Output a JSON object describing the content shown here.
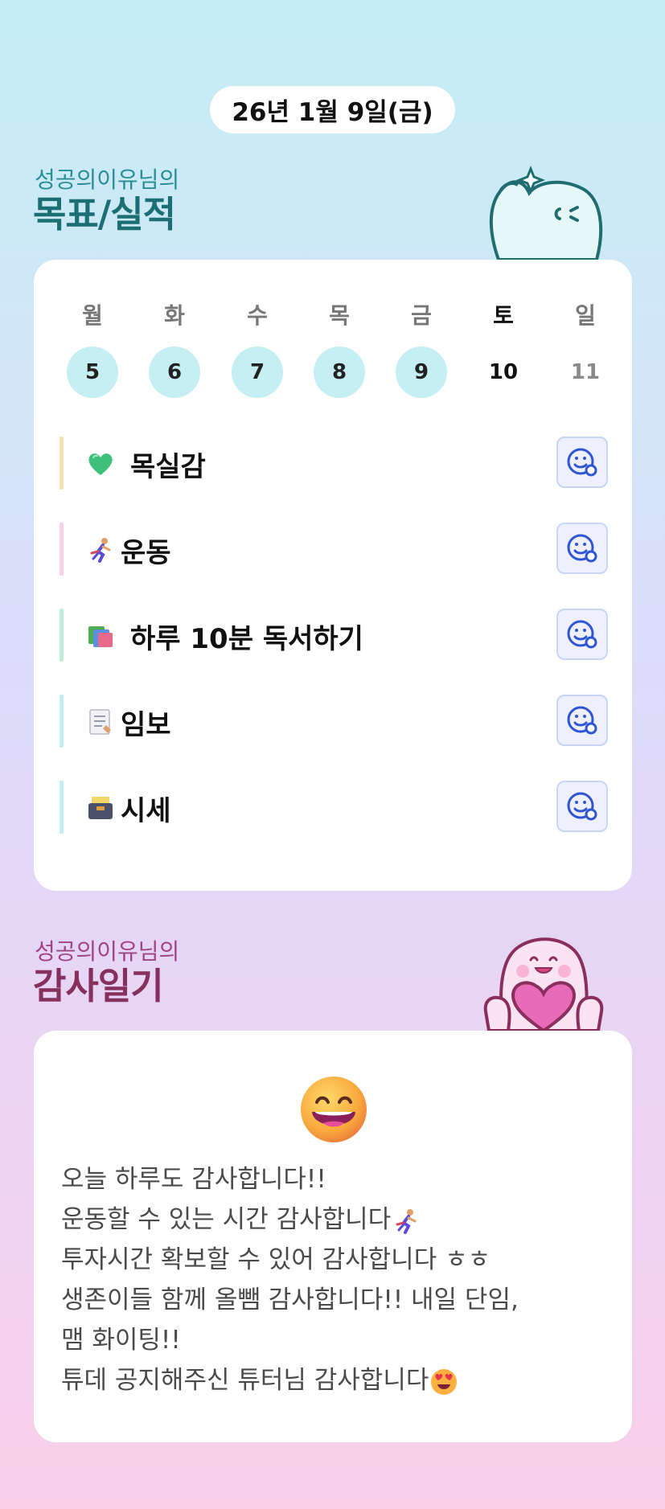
{
  "header": {
    "date": "26년 1월 9일(금)"
  },
  "goal_section": {
    "subtitle": "성공의이유님의",
    "title": "목표/실적",
    "week": [
      {
        "label": "월",
        "num": "5",
        "state": "done"
      },
      {
        "label": "화",
        "num": "6",
        "state": "done"
      },
      {
        "label": "수",
        "num": "7",
        "state": "done"
      },
      {
        "label": "목",
        "num": "8",
        "state": "done"
      },
      {
        "label": "금",
        "num": "9",
        "state": "done"
      },
      {
        "label": "토",
        "num": "10",
        "state": "today"
      },
      {
        "label": "일",
        "num": "11",
        "state": "future"
      }
    ],
    "goals": [
      {
        "emoji": "green-heart-icon",
        "label": "목실감",
        "bar_color": "#f8e2b0"
      },
      {
        "emoji": "runner-icon",
        "label": "운동",
        "bar_color": "#fbd0e6"
      },
      {
        "emoji": "books-icon",
        "label": "하루 10분 독서하기",
        "bar_color": "#bfecd6"
      },
      {
        "emoji": "memo-icon",
        "label": "임보",
        "bar_color": "#c2edf2"
      },
      {
        "emoji": "card-file-box-icon",
        "label": "시세",
        "bar_color": "#c2edf2"
      }
    ]
  },
  "thanks_section": {
    "subtitle": "성공의이유님의",
    "title": "감사일기",
    "mood_icon": "grinning-face-icon",
    "lines": [
      "오늘 하루도 감사합니다!!",
      "운동할 수 있는 시간 감사합니다",
      "투자시간 확보할 수 있어 감사합니다 ㅎㅎ",
      "생존이들 함께 올뺌 감사합니다!! 내일 단임,",
      "맴 화이팅!!",
      "튜데 공지해주신 튜터님 감사합니다"
    ]
  },
  "colors": {
    "goal_title": "#1b6f74",
    "thanks_title": "#86305e",
    "done_circle": "#c6eff3",
    "action_button_bg": "#eef1fd"
  }
}
